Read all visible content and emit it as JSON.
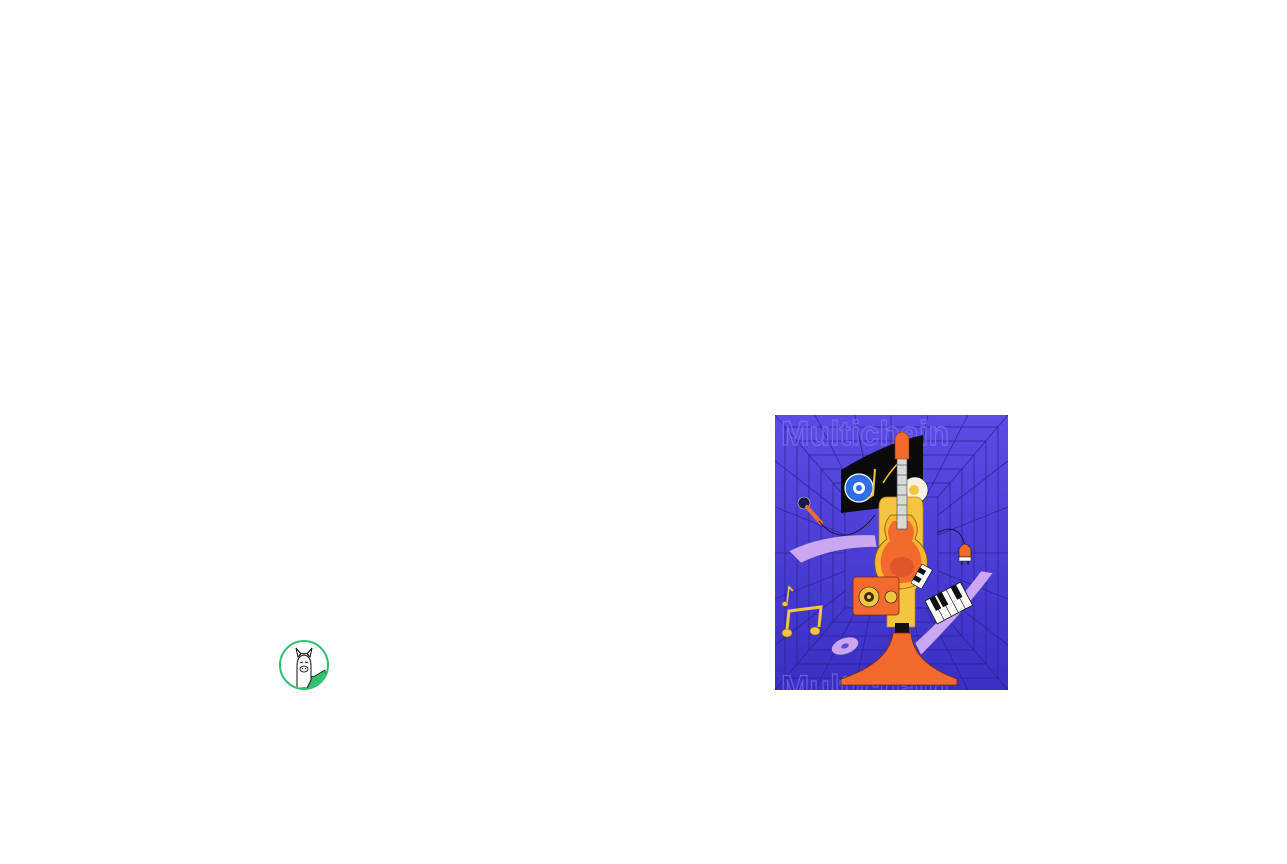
{
  "avatar": {
    "icon": "llama-icon",
    "ring_color": "#2fbf71"
  },
  "artwork": {
    "icon": "music-collage-illustration",
    "watermark_text": "Multichain",
    "colors": {
      "background": "#4a3fd8",
      "grid": "#2a1f8a",
      "guitar_body": "#f26a2e",
      "guitar_outline": "#f7b733",
      "accent_yellow": "#f5c542",
      "lavender": "#c9a7f2",
      "record_blue": "#2f6ee8"
    }
  }
}
